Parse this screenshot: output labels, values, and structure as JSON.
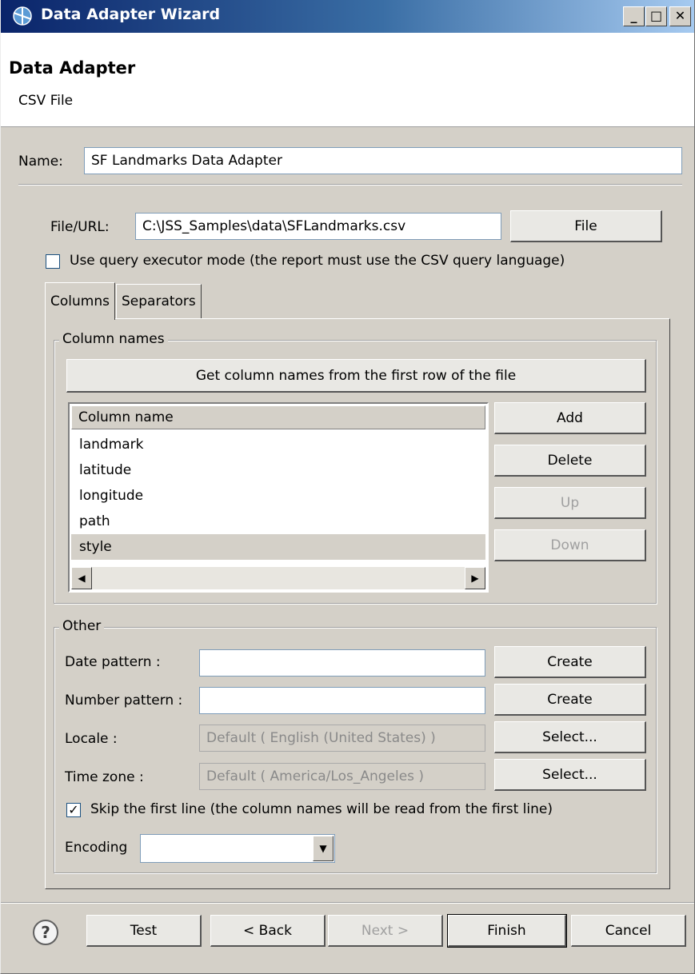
{
  "window": {
    "title": "Data Adapter Wizard",
    "controls": {
      "minimize": "_",
      "maximize": "□",
      "close": "✕"
    }
  },
  "header": {
    "title": "Data Adapter",
    "subtitle": "CSV File"
  },
  "name_field": {
    "label": "Name:",
    "value": "SF Landmarks Data Adapter"
  },
  "file_url": {
    "label": "File/URL:",
    "value": "C:\\JSS_Samples\\data\\SFLandmarks.csv",
    "button": "File"
  },
  "query_executor": {
    "checked": false,
    "label": "Use query executor mode (the report must use the CSV query language)"
  },
  "tabs": [
    {
      "label": "Columns",
      "active": true
    },
    {
      "label": "Separators",
      "active": false
    }
  ],
  "column_names": {
    "group_title": "Column names",
    "get_names_button": "Get column names from the first row of the file",
    "table_header": "Column name",
    "rows": [
      "landmark",
      "latitude",
      "longitude",
      "path",
      "style"
    ],
    "selected_row": "style",
    "buttons": {
      "add": "Add",
      "delete": "Delete",
      "up": "Up",
      "down": "Down"
    }
  },
  "other": {
    "group_title": "Other",
    "date_pattern": {
      "label": "Date pattern :",
      "value": "",
      "button": "Create"
    },
    "number_pattern": {
      "label": "Number pattern :",
      "value": "",
      "button": "Create"
    },
    "locale": {
      "label": "Locale :",
      "value": "Default ( English (United States) )",
      "button": "Select..."
    },
    "time_zone": {
      "label": "Time zone :",
      "value": "Default ( America/Los_Angeles )",
      "button": "Select..."
    },
    "skip_first_line": {
      "checked": true,
      "label": "Skip the first line (the column names will be read from the first line)"
    },
    "encoding": {
      "label": "Encoding",
      "value": ""
    }
  },
  "footer": {
    "help_glyph": "?",
    "test": "Test",
    "back": "< Back",
    "next": "Next >",
    "finish": "Finish",
    "cancel": "Cancel"
  },
  "colors": {
    "title_start": "#0a246a",
    "title_end": "#a6caf0",
    "dialog_bg": "#d4d0c8",
    "disabled_text": "#a0a0a0"
  }
}
